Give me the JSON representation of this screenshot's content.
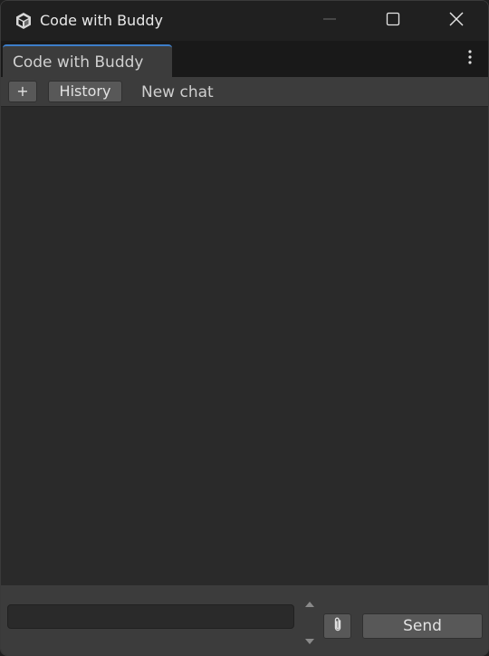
{
  "window": {
    "title": "Code with Buddy",
    "icon": "unity-cube-icon",
    "controls": [
      "minimize-icon",
      "maximize-icon",
      "close-icon"
    ]
  },
  "tabs": [
    {
      "label": "Code with Buddy",
      "active": true
    }
  ],
  "toolbar": {
    "new_button_label": "+",
    "history_button_label": "History",
    "conversation_title": "New chat"
  },
  "composer": {
    "input_value": "",
    "input_placeholder": "",
    "attach_icon": "paperclip-icon",
    "send_label": "Send"
  },
  "colors": {
    "titlebar_bg": "#202020",
    "tabstrip_bg": "#191919",
    "panel_bg": "#3c3c3c",
    "chat_bg": "#2a2a2a",
    "button_bg": "#585858",
    "tab_accent": "#3d7ec9"
  }
}
